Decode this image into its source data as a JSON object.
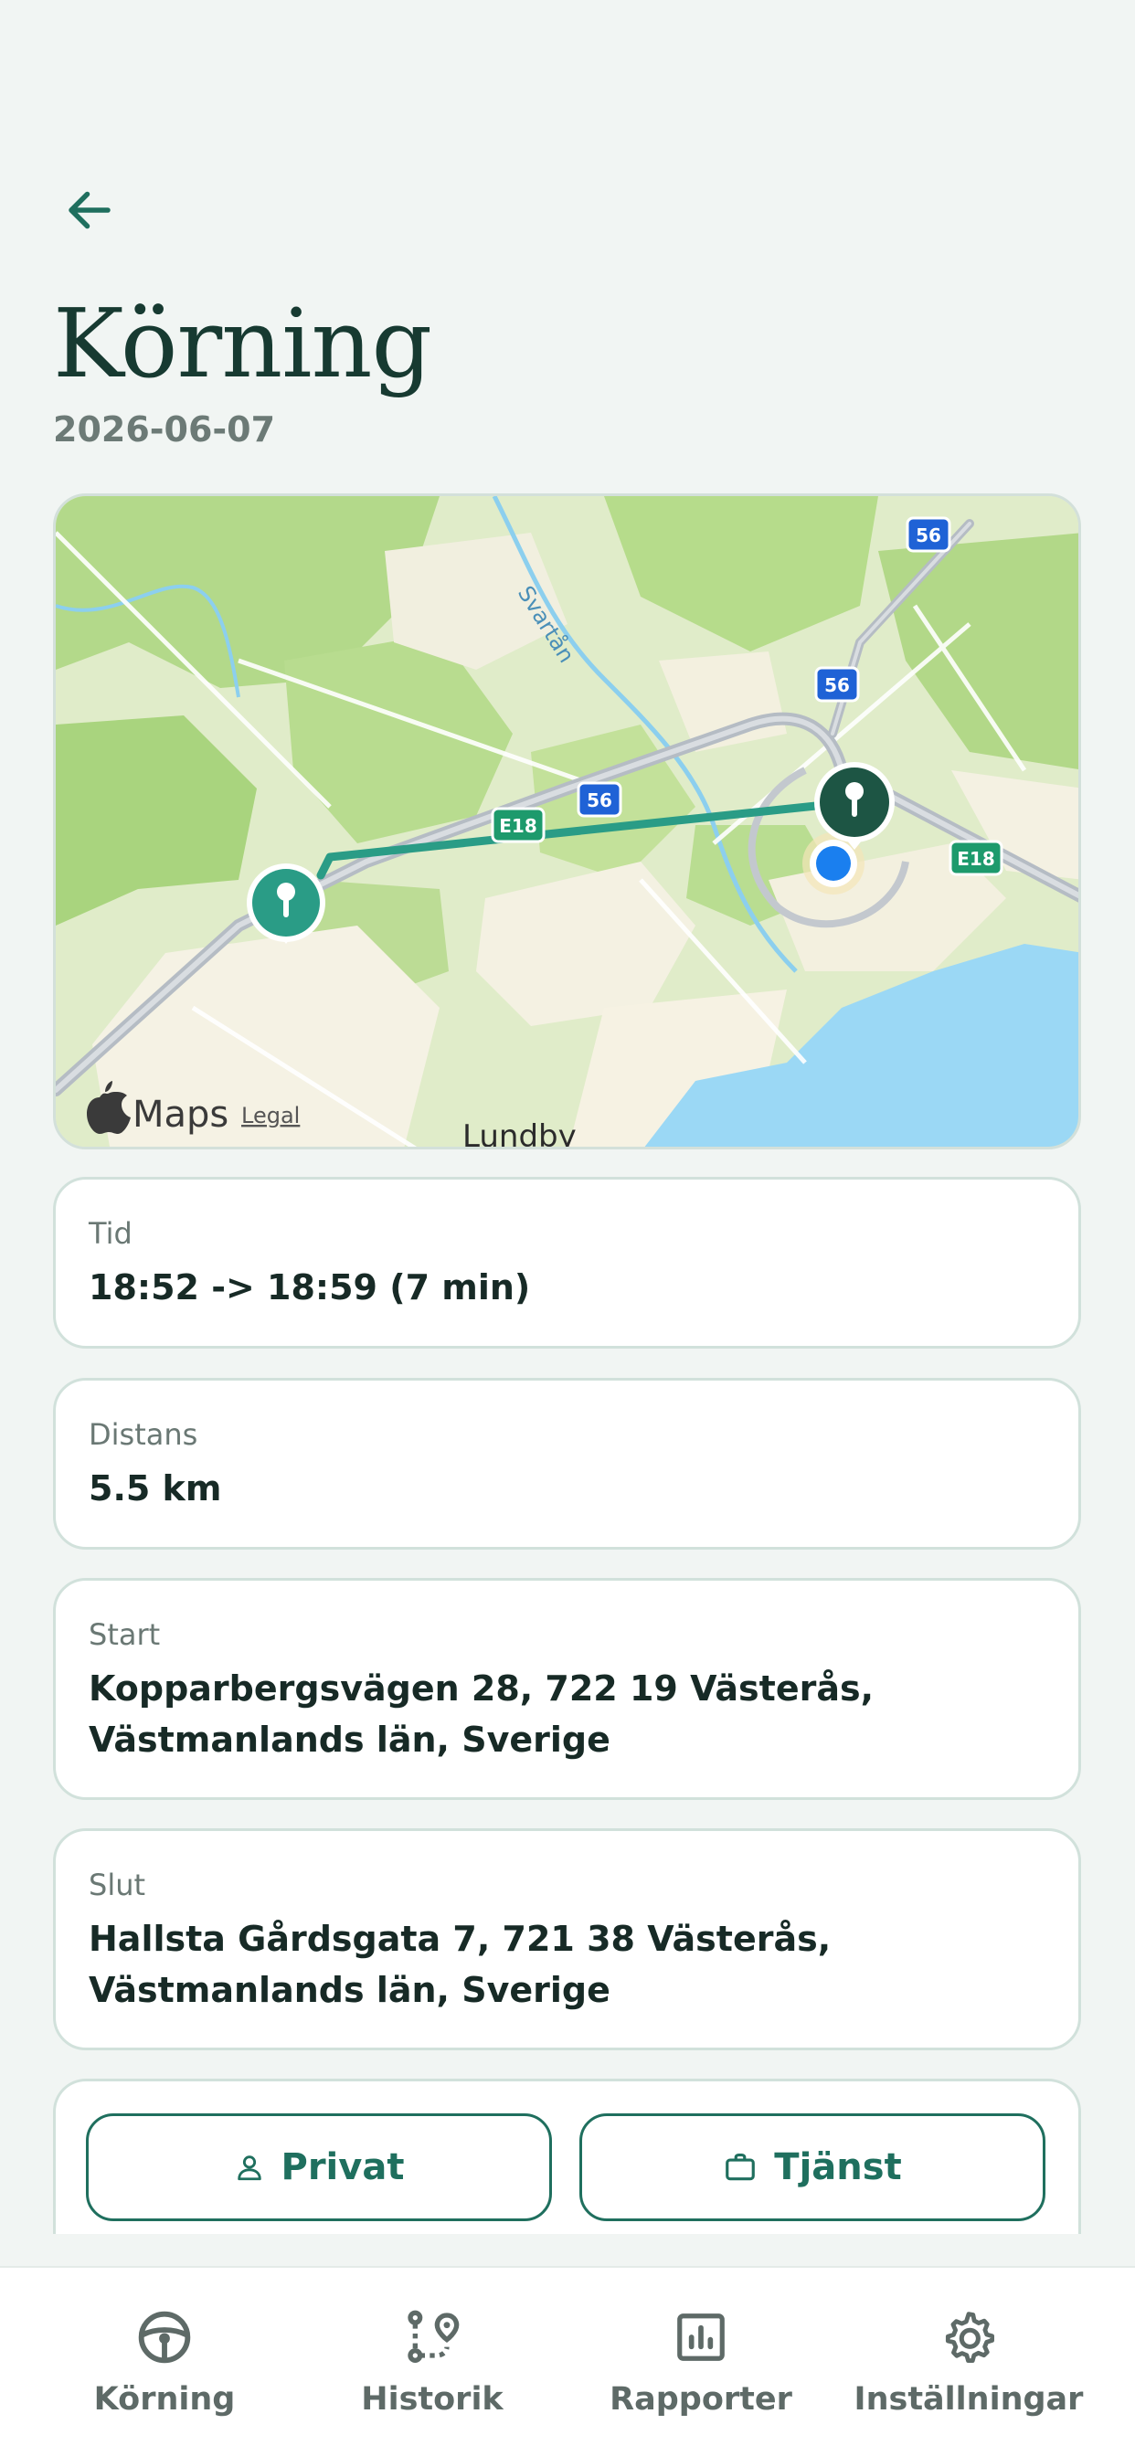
{
  "header": {
    "back_icon": "arrow-left-icon",
    "title": "Körning",
    "date": "2026-06-07"
  },
  "map": {
    "attribution": "Maps",
    "legal_link": "Legal",
    "labels": {
      "river": "Svartån",
      "district": "Lundby",
      "road_e18": "E18",
      "road_56": "56"
    },
    "colors": {
      "route": "#2a9c86",
      "water": "#9bd8f5",
      "vegetation": "#b6dc8e",
      "urban": "#f6f3e6",
      "road": "#b5bcc4",
      "location_dot": "#1a7fef",
      "pin_end": "#1d5544"
    }
  },
  "details": {
    "time": {
      "label": "Tid",
      "value": "18:52 -> 18:59 (7 min)"
    },
    "distance": {
      "label": "Distans",
      "value": "5.5 km"
    },
    "start": {
      "label": "Start",
      "value": "Kopparbergsvägen 28, 722 19 Västerås, Västmanlands län, Sverige"
    },
    "end": {
      "label": "Slut",
      "value": "Hallsta Gårdsgata 7, 721 38 Västerås, Västmanlands län, Sverige"
    }
  },
  "actions": {
    "private_label": "Privat",
    "private_icon": "person-icon",
    "business_label": "Tjänst",
    "business_icon": "briefcase-icon"
  },
  "tabbar": {
    "items": [
      {
        "label": "Körning",
        "icon": "steering-wheel-icon"
      },
      {
        "label": "Historik",
        "icon": "route-history-icon"
      },
      {
        "label": "Rapporter",
        "icon": "bar-chart-icon"
      },
      {
        "label": "Inställningar",
        "icon": "gear-icon"
      }
    ]
  },
  "colors": {
    "accent": "#1f6f5e",
    "background": "#f1f5f3",
    "card_border": "#d1e1db"
  }
}
